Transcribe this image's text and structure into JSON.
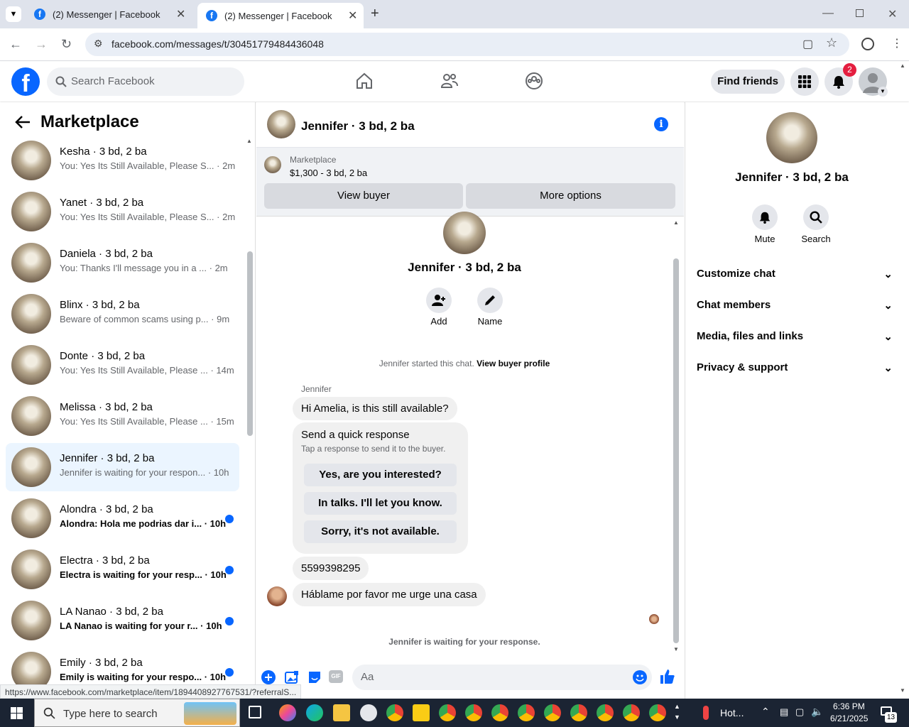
{
  "browser": {
    "tabs": [
      {
        "title": "(2) Messenger | Facebook"
      },
      {
        "title": "(2) Messenger | Facebook"
      }
    ],
    "url": "facebook.com/messages/t/30451779484436048",
    "status_link": "https://www.facebook.com/marketplace/item/1894408927767531/?referralS..."
  },
  "fb_header": {
    "search_placeholder": "Search Facebook",
    "find_friends": "Find friends",
    "notification_count": "2"
  },
  "left_pane": {
    "title": "Marketplace",
    "conversations": [
      {
        "name": "Kesha · 3 bd, 2 ba",
        "preview": "You: Yes Its Still Available, Please S...",
        "time": "· 2m",
        "unread": false,
        "selected": false
      },
      {
        "name": "Yanet · 3 bd, 2 ba",
        "preview": "You: Yes Its Still Available, Please S...",
        "time": "· 2m",
        "unread": false,
        "selected": false
      },
      {
        "name": "Daniela · 3 bd, 2 ba",
        "preview": "You: Thanks I'll message you in a ...",
        "time": "· 2m",
        "unread": false,
        "selected": false
      },
      {
        "name": "Blinx · 3 bd, 2 ba",
        "preview": "Beware of common scams using p...",
        "time": "· 9m",
        "unread": false,
        "selected": false
      },
      {
        "name": "Donte · 3 bd, 2 ba",
        "preview": "You: Yes Its Still Available, Please ...",
        "time": "· 14m",
        "unread": false,
        "selected": false
      },
      {
        "name": "Melissa · 3 bd, 2 ba",
        "preview": "You: Yes Its Still Available, Please ...",
        "time": "· 15m",
        "unread": false,
        "selected": false
      },
      {
        "name": "Jennifer · 3 bd, 2 ba",
        "preview": "Jennifer is waiting for your respon...",
        "time": "· 10h",
        "unread": false,
        "selected": true
      },
      {
        "name": "Alondra · 3 bd, 2 ba",
        "preview": "Alondra: Hola me podrias dar i...",
        "time": "· 10h",
        "unread": true,
        "selected": false
      },
      {
        "name": "Electra · 3 bd, 2 ba",
        "preview": "Electra is waiting for your resp...",
        "time": "· 10h",
        "unread": true,
        "selected": false
      },
      {
        "name": "LA Nanao · 3 bd, 2 ba",
        "preview": "LA Nanao is waiting for your r...",
        "time": "· 10h",
        "unread": true,
        "selected": false
      },
      {
        "name": "Emily · 3 bd, 2 ba",
        "preview": "Emily is waiting for your respo...",
        "time": "· 10h",
        "unread": true,
        "selected": false
      }
    ]
  },
  "chat": {
    "header_name": "Jennifer · 3 bd, 2 ba",
    "marketplace_label": "Marketplace",
    "listing_price": "$1,300 - 3 bd, 2 ba",
    "view_buyer": "View buyer",
    "more_options": "More options",
    "profile_name": "Jennifer · 3 bd, 2 ba",
    "add_label": "Add",
    "name_label": "Name",
    "started_text": "Jennifer started this chat.",
    "view_buyer_profile": "View buyer profile",
    "sender_name": "Jennifer",
    "messages": [
      "Hi Amelia, is this still available?",
      "5599398295",
      "Háblame por favor me urge una casa"
    ],
    "quick_response": {
      "title": "Send a quick response",
      "subtitle": "Tap a response to send it to the buyer.",
      "options": [
        "Yes, are you interested?",
        "In talks. I'll let you know.",
        "Sorry, it's not available."
      ]
    },
    "waiting_text": "Jennifer is waiting for your response.",
    "input_placeholder": "Aa"
  },
  "right_pane": {
    "name": "Jennifer · 3 bd, 2 ba",
    "mute": "Mute",
    "search": "Search",
    "sections": [
      "Customize chat",
      "Chat members",
      "Media, files and links",
      "Privacy & support"
    ]
  },
  "taskbar": {
    "search_placeholder": "Type here to search",
    "weather": "Hot...",
    "time": "6:36 PM",
    "date": "6/21/2025",
    "notifications": "13"
  },
  "colors": {
    "brand": "#0866ff",
    "badge": "#e41e3f",
    "selected": "#ebf5ff"
  }
}
